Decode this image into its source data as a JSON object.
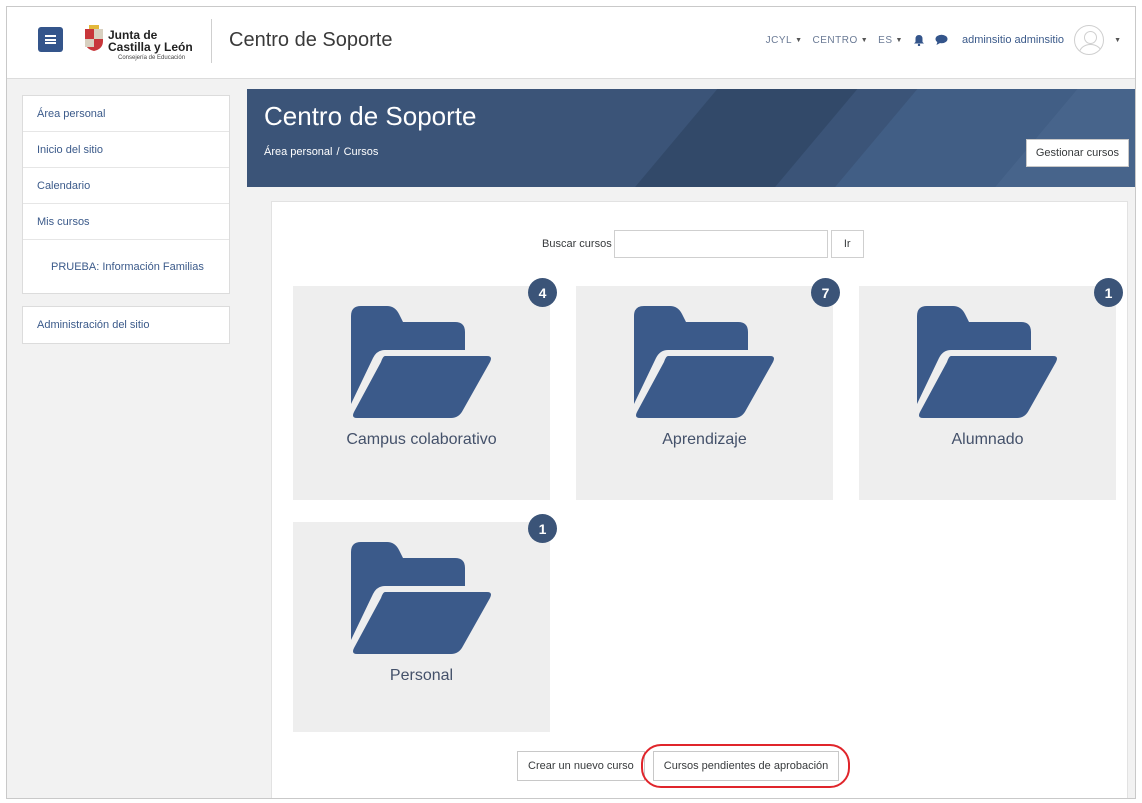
{
  "navbar": {
    "logo": {
      "line1": "Junta de",
      "line2": "Castilla y León",
      "line3": "Consejería de Educación"
    },
    "site_title": "Centro de Soporte",
    "menus": [
      "JCYL",
      "CENTRO",
      "ES"
    ],
    "username": "adminsitio adminsitio",
    "icons": [
      "hamburger-icon",
      "bell-icon",
      "chat-icon",
      "avatar-icon"
    ]
  },
  "sidebar": {
    "items": [
      {
        "label": "Área personal"
      },
      {
        "label": "Inicio del sitio"
      },
      {
        "label": "Calendario"
      },
      {
        "label": "Mis cursos"
      },
      {
        "label": "PRUEBA: Información Familias"
      }
    ],
    "admin": {
      "label": "Administración del sitio"
    }
  },
  "header": {
    "title": "Centro de Soporte",
    "breadcrumb": [
      "Área personal",
      "/",
      "Cursos"
    ],
    "manage_button": "Gestionar cursos"
  },
  "search": {
    "label": "Buscar cursos",
    "value": "",
    "button": "Ir"
  },
  "categories": [
    {
      "name": "Campus colaborativo",
      "count": "4"
    },
    {
      "name": "Aprendizaje",
      "count": "7"
    },
    {
      "name": "Alumnado",
      "count": "1"
    },
    {
      "name": "Personal",
      "count": "1"
    }
  ],
  "actions": {
    "new_course": "Crear un nuevo curso",
    "pending": "Cursos pendientes de aprobación"
  },
  "colors": {
    "brand": "#3b5478",
    "link": "#3b5a8a",
    "highlight_ring": "#e0252b"
  }
}
